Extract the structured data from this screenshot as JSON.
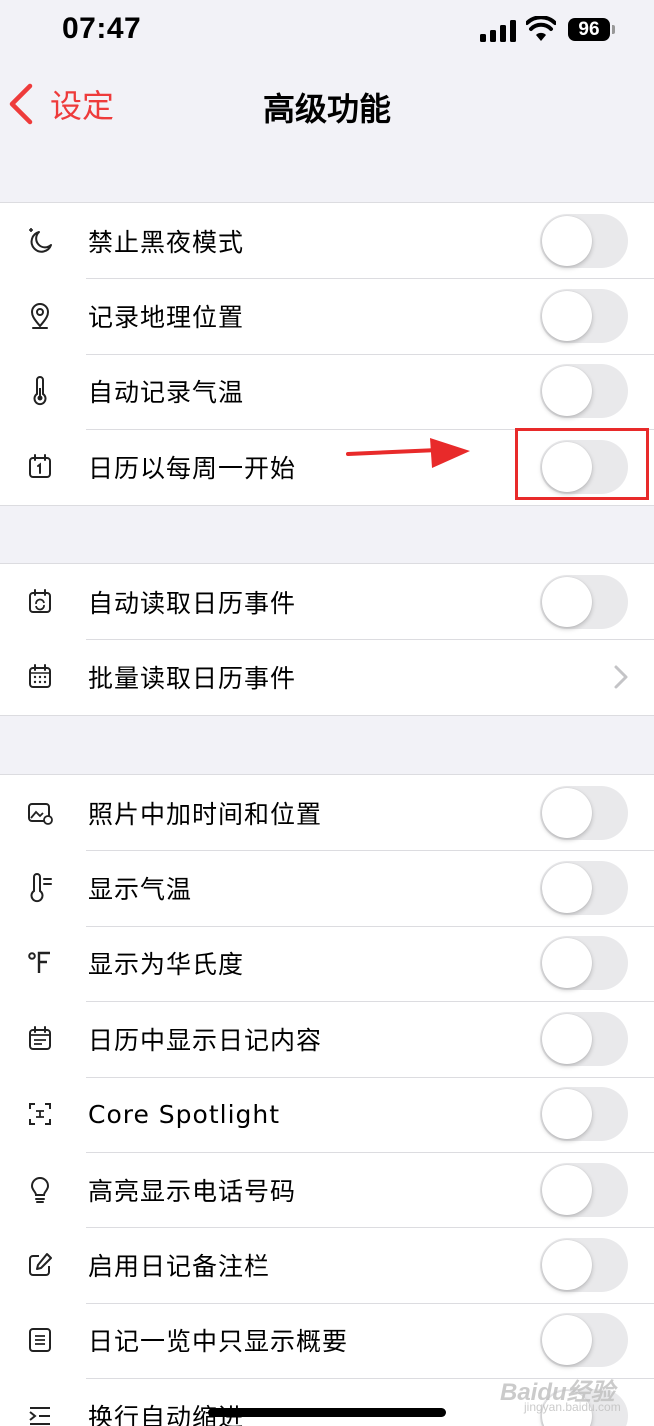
{
  "status_bar": {
    "time": "07:47",
    "battery": "96"
  },
  "nav": {
    "back_label": "设定",
    "title": "高级功能"
  },
  "colors": {
    "accent": "#ee3b3b",
    "toggle_off": "#e9e9eb",
    "background": "#f2f2f7",
    "annotation": "#e82a2a"
  },
  "groups": [
    {
      "rows": [
        {
          "label": "禁止黑夜模式",
          "icon": "moon-stars-icon",
          "control": "toggle",
          "on": false
        },
        {
          "label": "记录地理位置",
          "icon": "location-pin-icon",
          "control": "toggle",
          "on": false
        },
        {
          "label": "自动记录气温",
          "icon": "thermometer-icon",
          "control": "toggle",
          "on": false
        },
        {
          "label": "日历以每周一开始",
          "icon": "calendar-one-icon",
          "control": "toggle",
          "on": false
        }
      ]
    },
    {
      "rows": [
        {
          "label": "自动读取日历事件",
          "icon": "calendar-sync-icon",
          "control": "toggle",
          "on": false
        },
        {
          "label": "批量读取日历事件",
          "icon": "calendar-grid-icon",
          "control": "chevron"
        }
      ]
    },
    {
      "rows": [
        {
          "label": "照片中加时间和位置",
          "icon": "photo-location-icon",
          "control": "toggle",
          "on": false
        },
        {
          "label": "显示气温",
          "icon": "thermometer-lines-icon",
          "control": "toggle",
          "on": false
        },
        {
          "label": "显示为华氏度",
          "icon": "fahrenheit-icon",
          "control": "toggle",
          "on": false
        },
        {
          "label": "日历中显示日记内容",
          "icon": "calendar-list-icon",
          "control": "toggle",
          "on": false
        },
        {
          "label": "Core Spotlight",
          "icon": "spotlight-scan-icon",
          "control": "toggle",
          "on": false
        },
        {
          "label": "高亮显示电话号码",
          "icon": "lightbulb-icon",
          "control": "toggle",
          "on": false
        },
        {
          "label": "启用日记备注栏",
          "icon": "edit-note-icon",
          "control": "toggle",
          "on": false
        },
        {
          "label": "日记一览中只显示概要",
          "icon": "document-lines-icon",
          "control": "toggle",
          "on": false
        },
        {
          "label": "换行自动缩进",
          "icon": "indent-icon",
          "control": "toggle",
          "on": false
        }
      ]
    }
  ],
  "watermark": {
    "text": "Baidu经验",
    "sub": "jingyan.baidu.com"
  }
}
